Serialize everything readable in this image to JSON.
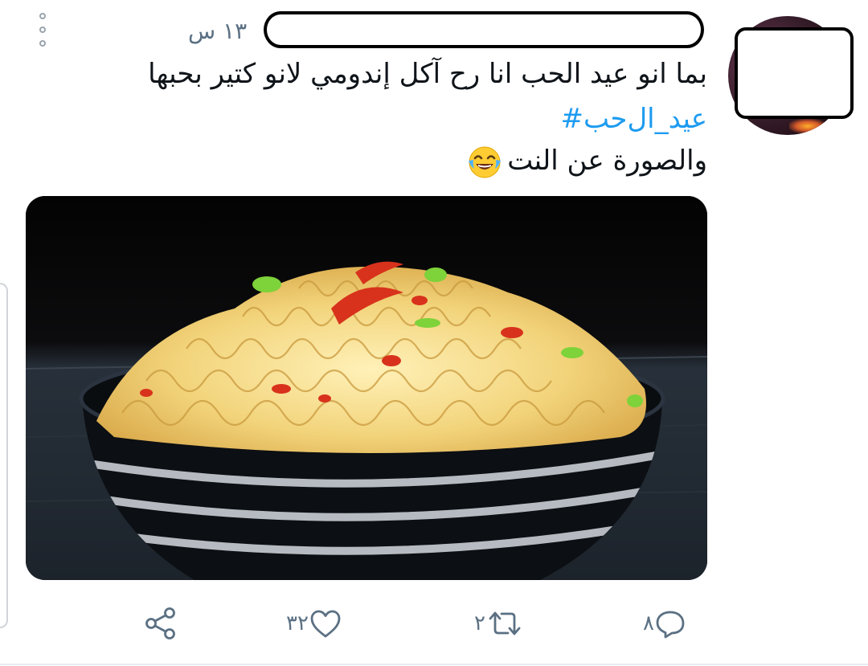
{
  "tweet": {
    "timestamp": "١٣ س",
    "text_line1": "بما انو عيد الحب انا رح آكل إندومي لانو كتير بحبها",
    "hashtag": "#عيد_ال‌حب",
    "text_line3": "والصورة عن النت"
  },
  "actions": {
    "reply_count": "٨",
    "retweet_count": "٢",
    "like_count": "٣٢"
  },
  "colors": {
    "hashtag": "#1d9bf0",
    "meta": "#5b7083",
    "icon": "#5b7083"
  },
  "icons": [
    "more-vertical-icon",
    "reply-icon",
    "retweet-icon",
    "like-icon",
    "share-icon",
    "face-with-tears-of-joy-emoji"
  ]
}
